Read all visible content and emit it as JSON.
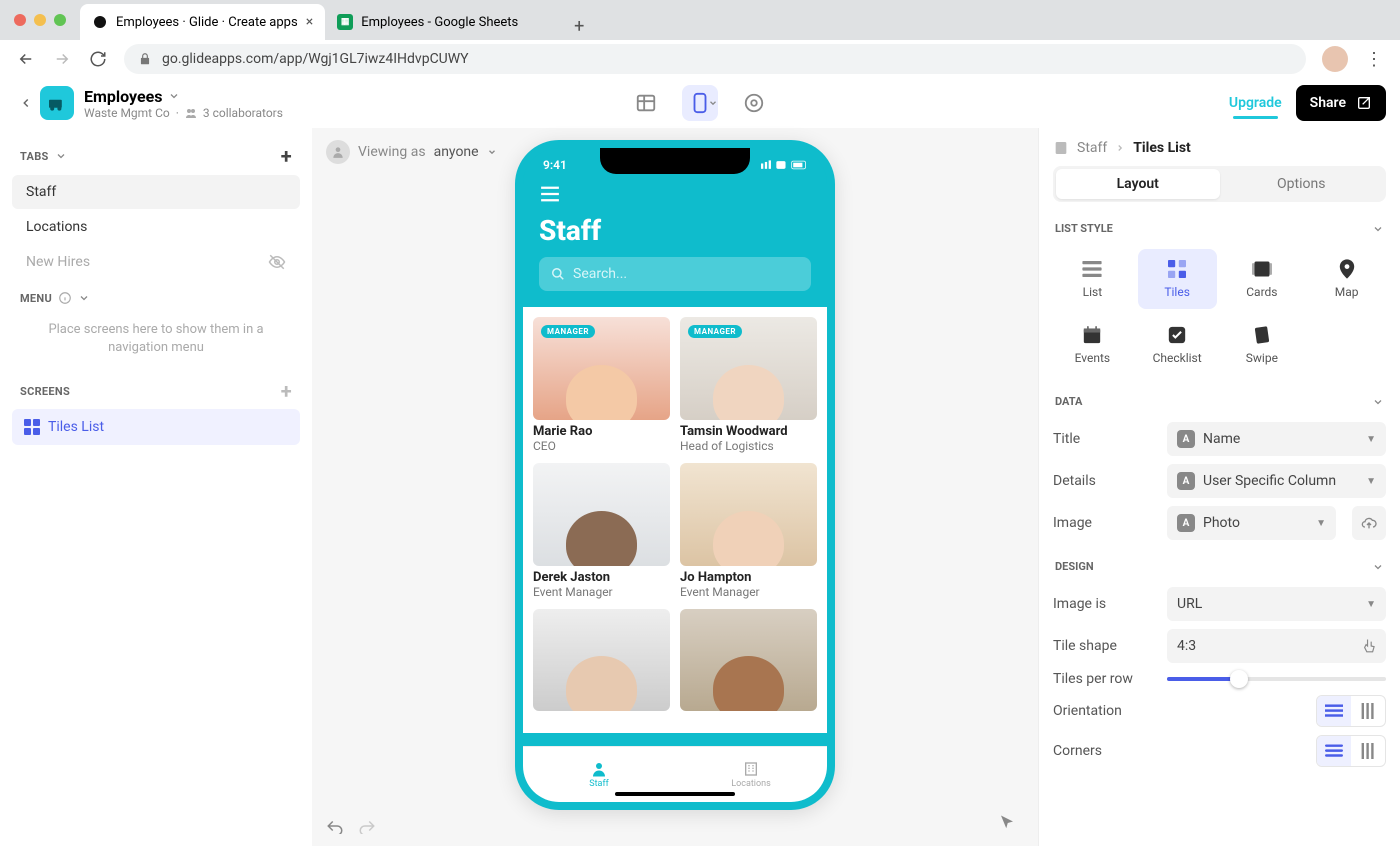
{
  "browser": {
    "tabs": [
      {
        "title": "Employees · Glide · Create apps"
      },
      {
        "title": "Employees - Google Sheets"
      }
    ],
    "url": "go.glideapps.com/app/Wgj1GL7iwz4IHdvpCUWY"
  },
  "app": {
    "name": "Employees",
    "org": "Waste Mgmt Co",
    "collab_label": "3 collaborators",
    "upgrade": "Upgrade",
    "share": "Share"
  },
  "sidebar": {
    "tabs_head": "TABS",
    "tabs": [
      {
        "label": "Staff",
        "active": true
      },
      {
        "label": "Locations"
      },
      {
        "label": "New Hires",
        "disabled": true
      }
    ],
    "menu_head": "MENU",
    "menu_empty": "Place screens here to show them in a navigation menu",
    "screens_head": "SCREENS",
    "screens": [
      {
        "label": "Tiles List"
      }
    ]
  },
  "viewing": {
    "as": "Viewing as",
    "who": "anyone"
  },
  "phone": {
    "time": "9:41",
    "title": "Staff",
    "search_placeholder": "Search...",
    "tiles": [
      {
        "name": "Marie Rao",
        "role": "CEO",
        "badge": "MANAGER"
      },
      {
        "name": "Tamsin Woodward",
        "role": "Head of Logistics",
        "badge": "MANAGER"
      },
      {
        "name": "Derek Jaston",
        "role": "Event Manager"
      },
      {
        "name": "Jo Hampton",
        "role": "Event Manager"
      }
    ],
    "tabs": [
      {
        "label": "Staff",
        "active": true
      },
      {
        "label": "Locations"
      }
    ]
  },
  "panel": {
    "crumb_parent": "Staff",
    "crumb_current": "Tiles List",
    "seg_layout": "Layout",
    "seg_options": "Options",
    "list_style_head": "LIST STYLE",
    "styles": [
      {
        "label": "List"
      },
      {
        "label": "Tiles",
        "active": true
      },
      {
        "label": "Cards"
      },
      {
        "label": "Map"
      },
      {
        "label": "Events"
      },
      {
        "label": "Checklist"
      },
      {
        "label": "Swipe"
      }
    ],
    "data_head": "DATA",
    "fields": {
      "title": {
        "label": "Title",
        "value": "Name"
      },
      "details": {
        "label": "Details",
        "value": "User Specific Column"
      },
      "image": {
        "label": "Image",
        "value": "Photo"
      }
    },
    "design_head": "DESIGN",
    "design": {
      "image_is": {
        "label": "Image is",
        "value": "URL"
      },
      "tile_shape": {
        "label": "Tile shape",
        "value": "4:3"
      },
      "tiles_per_row": {
        "label": "Tiles per row"
      },
      "orientation": {
        "label": "Orientation"
      },
      "corners": {
        "label": "Corners"
      }
    }
  }
}
